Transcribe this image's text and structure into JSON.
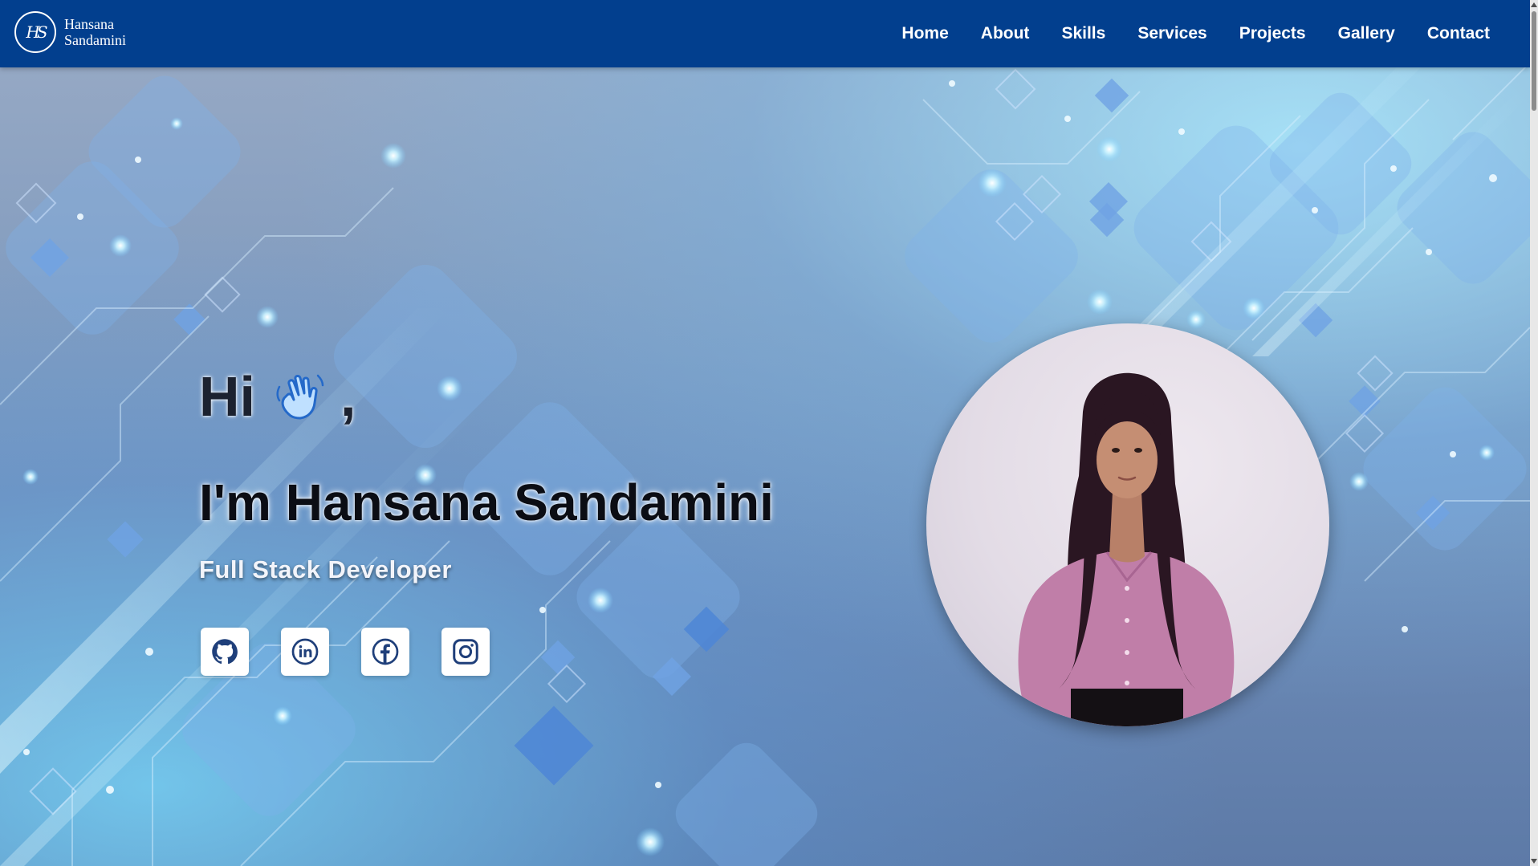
{
  "brand": {
    "monogram": "HS",
    "name_line1": "Hansana",
    "name_line2": "Sandamini"
  },
  "nav": {
    "items": [
      {
        "label": "Home"
      },
      {
        "label": "About"
      },
      {
        "label": "Skills"
      },
      {
        "label": "Services"
      },
      {
        "label": "Projects"
      },
      {
        "label": "Gallery"
      },
      {
        "label": "Contact"
      }
    ]
  },
  "hero": {
    "greeting": "Hi",
    "greeting_icon": "waving-hand-icon",
    "greeting_suffix": ",",
    "name": "I'm Hansana Sandamini",
    "role": "Full Stack Developer",
    "portrait_alt": "Hansana Sandamini portrait"
  },
  "socials": [
    {
      "icon": "github-icon"
    },
    {
      "icon": "linkedin-icon"
    },
    {
      "icon": "facebook-icon"
    },
    {
      "icon": "instagram-icon"
    }
  ],
  "colors": {
    "navbar": "#023f8e",
    "accent_icon": "#1f3f7a",
    "role_text": "#f2f4fa",
    "name_text": "#0b0d14"
  }
}
